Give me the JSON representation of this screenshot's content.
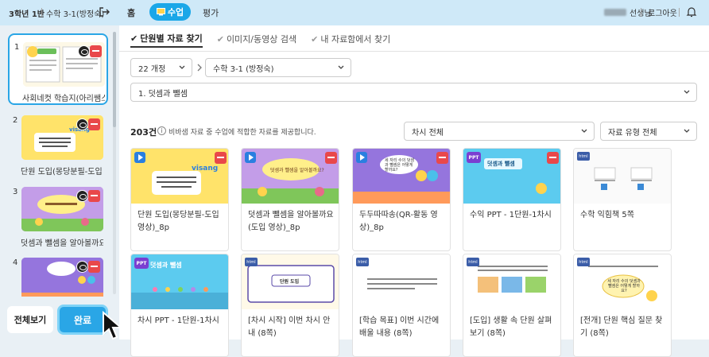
{
  "topbar": {
    "class_name": "3학년 1반",
    "subject": "수학 3-1(방정숙)",
    "home": "홈",
    "class_tab": "수업",
    "eval": "평가",
    "teacher": "선생님",
    "logout": "로그아웃"
  },
  "sidebar": {
    "items": [
      {
        "num": "1",
        "label": "사회네컷 학습지(아리쌤스..."
      },
      {
        "num": "2",
        "label": "단원 도입(몽당분필-도입 ..."
      },
      {
        "num": "3",
        "label": "덧셈과 뺄셈을 알아볼까요(..."
      },
      {
        "num": "4",
        "label": ""
      }
    ],
    "btn_all": "전체보기",
    "btn_done": "완료"
  },
  "tabs": [
    {
      "label": "단원별 자료 찾기"
    },
    {
      "label": "이미지/동영상 검색"
    },
    {
      "label": "내 자료함에서 찾기"
    }
  ],
  "filters": {
    "revision": "22 개정",
    "subject": "수학 3-1 (방정숙)",
    "unit": "1. 덧셈과 뺄셈",
    "period": "차시 전체",
    "type": "자료 유형 전체"
  },
  "results": {
    "count": "203건",
    "info_icon": "i",
    "info": "비바샘 자료 중 수업에 적합한 자료를 제공합니다."
  },
  "cards": [
    {
      "label": "단원 도입(몽당분필-도입 영상)_8p",
      "type": "video"
    },
    {
      "label": "덧셈과 뺄셈을 알아볼까요(도입 영상)_8p",
      "type": "video"
    },
    {
      "label": "두두따따송(QR-활동 영상)_8p",
      "type": "video"
    },
    {
      "label": "수익 PPT - 1단원-1차시",
      "type": "ppt"
    },
    {
      "label": "수학 익힘책 5쪽",
      "type": "html"
    },
    {
      "label": "차시 PPT - 1단원-1차시",
      "type": "ppt"
    },
    {
      "label": "[차시 시작] 이번 차시 안내 (8쪽)",
      "type": "html"
    },
    {
      "label": "[학습 목표] 이번 시간에 배울 내용 (8쪽)",
      "type": "html"
    },
    {
      "label": "[도입] 생활 속 단원 살펴보기 (8쪽)",
      "type": "html"
    },
    {
      "label": "[전개] 단원 핵심 질문 찾기 (8쪽)",
      "type": "html"
    }
  ],
  "thumb_text": {
    "visang": "visang",
    "intro": "수학 3학년 1학기\n1단원 덧셈과 뺄셈\n1차시 단원 도입",
    "q1": "덧셈과 뺄셈을 알아볼까요?",
    "ppt_title": "덧셈과 뺄셈",
    "intro2": "단원 도입",
    "song_q": "세 자리 수의 덧셈과 뺄셈은 어떻게 할까요?",
    "ppt_badge": "PPT",
    "html_badge": "html"
  },
  "colors": {
    "accent": "#2aa6e6",
    "topbar": "#cfe9f8",
    "danger": "#e9484a"
  }
}
